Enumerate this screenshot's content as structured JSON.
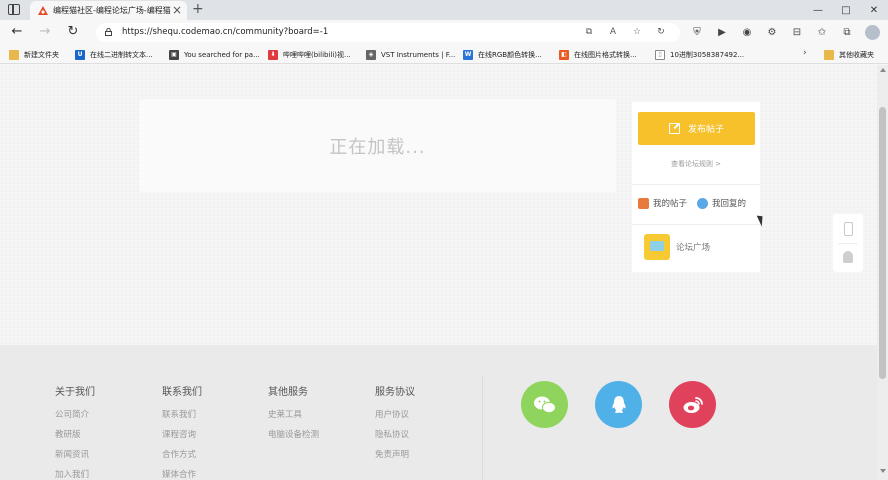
{
  "browser": {
    "tab_title": "编程猫社区-编程论坛广场-编程猫",
    "url": "https://shequ.codemao.cn/community?board=-1",
    "tab_close": "×",
    "new_tab": "+",
    "win_minimize": "—",
    "win_maximize": "□",
    "win_close": "✕"
  },
  "bookmarks": {
    "items": [
      {
        "label": "新建文件夹",
        "icon": "folder-icon",
        "color": "#e8b84a"
      },
      {
        "label": "在线二进制转文本...",
        "icon": "u-icon",
        "color": "#1b66c9",
        "glyph": "U"
      },
      {
        "label": "You searched for pa...",
        "icon": "page-icon",
        "color": "#444444",
        "glyph": "▣"
      },
      {
        "label": "哔哩哔哩(bilibili)视...",
        "icon": "bilibili-icon",
        "color": "#e0393e",
        "glyph": "⬇"
      },
      {
        "label": "VST Instruments | F...",
        "icon": "vst-icon",
        "color": "#666666",
        "glyph": "◈"
      },
      {
        "label": "在线RGB颜色转换...",
        "icon": "rgb-icon",
        "color": "#2a73d8",
        "glyph": "W"
      },
      {
        "label": "在线图片格式转换...",
        "icon": "convert-icon",
        "color": "#e85a1f",
        "glyph": "◧"
      },
      {
        "label": "10进制3058387492...",
        "icon": "doc-icon",
        "color": "#888888",
        "glyph": "▯"
      }
    ],
    "more_label": "其他收藏夹"
  },
  "main": {
    "loading_text": "正在加载..."
  },
  "sidebar": {
    "post_button": "发布帖子",
    "rules_link": "查看论坛规则 >",
    "my_posts": "我的帖子",
    "my_replies": "我回复的",
    "forum_plaza": "论坛广场"
  },
  "footer": {
    "columns": [
      {
        "heading": "关于我们",
        "links": [
          "公司简介",
          "教研版",
          "新闻资讯",
          "加入我们"
        ]
      },
      {
        "heading": "联系我们",
        "links": [
          "联系我们",
          "课程咨询",
          "合作方式",
          "媒体合作"
        ]
      },
      {
        "heading": "其他服务",
        "links": [
          "史莱工具",
          "电脑设备检测"
        ]
      },
      {
        "heading": "服务协议",
        "links": [
          "用户协议",
          "隐私协议",
          "免责声明"
        ]
      }
    ],
    "social": [
      {
        "name": "wechat-icon",
        "color": "#8fd45c"
      },
      {
        "name": "qq-icon",
        "color": "#4fb1e8"
      },
      {
        "name": "weibo-icon",
        "color": "#e0415b"
      }
    ]
  }
}
